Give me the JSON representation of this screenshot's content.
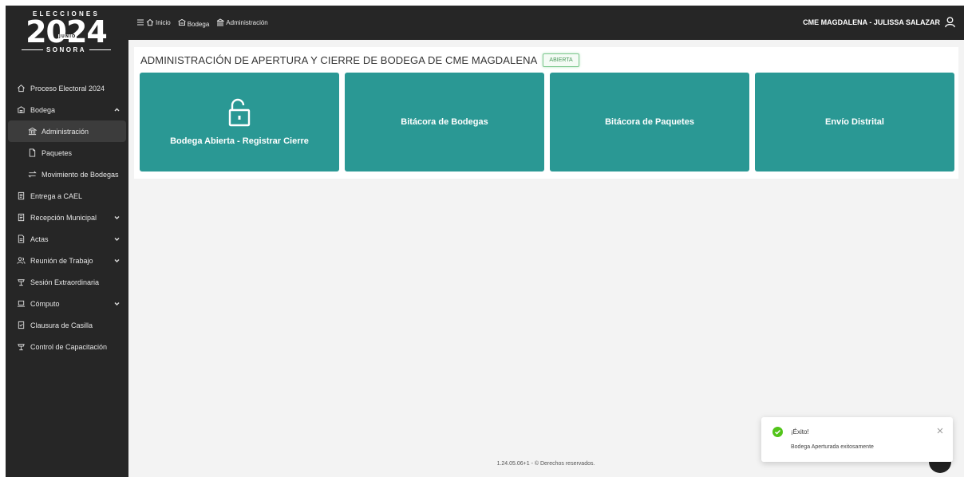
{
  "logo": {
    "top": "ELECCIONES",
    "year": "2024",
    "month": "JUNIO",
    "bottom": "SONORA"
  },
  "sidebar": {
    "items": [
      {
        "label": "Proceso Electoral 2024",
        "icon": "home-icon"
      },
      {
        "label": "Bodega",
        "icon": "warehouse-icon",
        "expanded": true
      },
      {
        "label": "Administración",
        "icon": "bank-icon",
        "active": true
      },
      {
        "label": "Paquetes",
        "icon": "file-icon"
      },
      {
        "label": "Movimiento de Bodegas",
        "icon": "swap-icon"
      },
      {
        "label": "Entrega a CAEL",
        "icon": "clipboard-icon"
      },
      {
        "label": "Recepción Municipal",
        "icon": "clipboard-icon",
        "expandable": true
      },
      {
        "label": "Actas",
        "icon": "file-text-icon",
        "expandable": true
      },
      {
        "label": "Reunión de Trabajo",
        "icon": "team-icon",
        "expandable": true
      },
      {
        "label": "Sesión Extraordinaria",
        "icon": "lecturn-icon"
      },
      {
        "label": "Cómputo",
        "icon": "laptop-icon",
        "expandable": true
      },
      {
        "label": "Clausura de Casilla",
        "icon": "clipboard-check-icon"
      },
      {
        "label": "Control de Capacitación",
        "icon": "lecturn-icon"
      }
    ]
  },
  "topbar": {
    "breadcrumbs": [
      "Inicio",
      "Bodega",
      "Administración"
    ],
    "user": "CME MAGDALENA - JULISSA SALAZAR"
  },
  "main": {
    "title": "ADMINISTRACIÓN DE APERTURA Y CIERRE DE BODEGA DE CME MAGDALENA",
    "status": "ABIERTA",
    "cards": [
      {
        "label": "Bodega Abierta - Registrar Cierre",
        "icon": "unlock-icon"
      },
      {
        "label": "Bitácora de Bodegas"
      },
      {
        "label": "Bitácora de Paquetes"
      },
      {
        "label": "Envío Distrital"
      }
    ]
  },
  "footer": {
    "text": "1.24.05.06+1 - © Derechos reservados."
  },
  "toast": {
    "title": "¡Éxito!",
    "message": "Bodega Aperturada exitosamente"
  },
  "colors": {
    "sidebar": "#262626",
    "card": "#2a9894",
    "success": "#52c41a"
  }
}
